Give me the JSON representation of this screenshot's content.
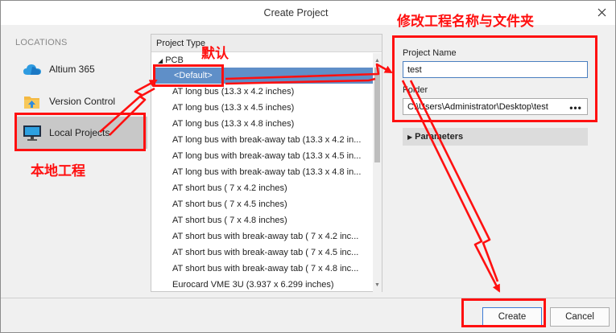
{
  "window": {
    "title": "Create Project"
  },
  "sidebar": {
    "heading": "LOCATIONS",
    "items": [
      {
        "label": "Altium 365",
        "icon": "cloud-icon"
      },
      {
        "label": "Version Control",
        "icon": "folder-upload-icon"
      },
      {
        "label": "Local Projects",
        "icon": "monitor-icon",
        "selected": true
      }
    ]
  },
  "project_types": {
    "header": "Project Type",
    "group": "PCB",
    "items": [
      "<Default>",
      "AT long bus (13.3 x 4.2 inches)",
      "AT long bus (13.3 x 4.5 inches)",
      "AT long bus (13.3 x 4.8 inches)",
      "AT long bus with break-away tab (13.3 x 4.2 in...",
      "AT long bus with break-away tab (13.3 x 4.5 in...",
      "AT long bus with break-away tab (13.3 x 4.8 in...",
      "AT short bus ( 7 x 4.2 inches)",
      "AT short bus ( 7 x 4.5 inches)",
      "AT short bus ( 7 x 4.8 inches)",
      "AT short bus with break-away tab ( 7 x 4.2 inc...",
      "AT short bus with break-away tab ( 7 x 4.5 inc...",
      "AT short bus with break-away tab ( 7 x 4.8 inc...",
      "Eurocard VME 3U (3.937 x 6.299 inches)"
    ]
  },
  "form": {
    "project_name_label": "Project Name",
    "project_name_value": "test",
    "folder_label": "Folder",
    "folder_value": "C:\\Users\\Administrator\\Desktop\\test",
    "browse_label": "•••",
    "parameters_label": "Parameters"
  },
  "buttons": {
    "create": "Create",
    "cancel": "Cancel"
  },
  "annotations": {
    "default": "默认",
    "local_project": "本地工程",
    "rename": "修改工程名称与文件夹",
    "color": "#ff1010"
  }
}
